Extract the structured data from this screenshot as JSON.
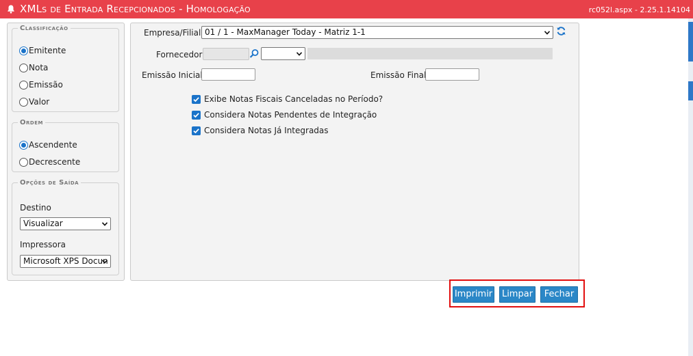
{
  "header": {
    "title": "XMLs de Entrada Recepcionados  - Homologação",
    "version": "rc052l.aspx - 2.25.1.14104"
  },
  "left": {
    "classificacao": {
      "legend": "Classificação",
      "options": [
        "Emitente",
        "Nota",
        "Emissão",
        "Valor"
      ],
      "selected": "Emitente"
    },
    "ordem": {
      "legend": "Ordem",
      "options": [
        "Ascendente",
        "Decrescente"
      ],
      "selected": "Ascendente"
    },
    "saida": {
      "legend": "Opções de Saída",
      "destino_label": "Destino",
      "destino_value": "Visualizar",
      "impressora_label": "Impressora",
      "impressora_value": "Microsoft XPS Docun"
    }
  },
  "form": {
    "empresa_label": "Empresa/Filial:",
    "empresa_value": "01 / 1 - MaxManager Today - Matriz 1-1",
    "fornecedor_label": "Fornecedor:",
    "fornecedor_value": "",
    "emissao_inicial_label": "Emissão Inicial:",
    "emissao_inicial_value": "",
    "emissao_final_label": "Emissão Final:",
    "emissao_final_value": "",
    "checkboxes": [
      {
        "label": "Exibe Notas Fiscais Canceladas no Período?",
        "checked": true
      },
      {
        "label": "Considera Notas Pendentes de Integração",
        "checked": true
      },
      {
        "label": "Considera Notas Já Integradas",
        "checked": true
      }
    ]
  },
  "buttons": {
    "imprimir": "Imprimir",
    "limpar": "Limpar",
    "fechar": "Fechar"
  },
  "colors": {
    "header": "#e8414a",
    "accent": "#1a73c9",
    "button": "#2b87c7",
    "highlight": "#e20d0d"
  },
  "icons": [
    "bell-icon",
    "refresh-icon",
    "search-icon",
    "chevron-down-icon",
    "checkmark-icon"
  ]
}
